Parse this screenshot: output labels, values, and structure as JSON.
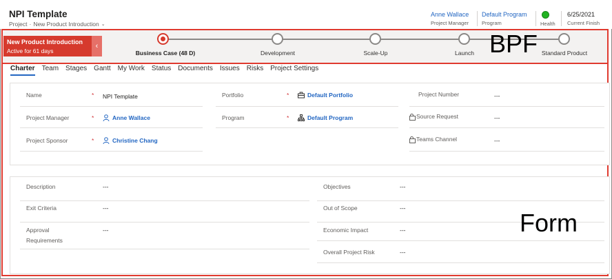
{
  "header": {
    "title": "NPI Template",
    "breadcrumb_entity": "Project",
    "breadcrumb_sep": "·",
    "breadcrumb_form": "New Product Introduction",
    "fields": [
      {
        "value": "Anne Wallace",
        "label": "Project Manager"
      },
      {
        "value": "Default Program",
        "label": "Program"
      },
      {
        "value": "",
        "label": "Health"
      },
      {
        "value": "6/25/2021",
        "label": "Current Finish"
      }
    ],
    "health_color": "#21b321"
  },
  "bpf": {
    "process_name": "New Product Introduction",
    "active_duration": "Active for 61 days",
    "stages": [
      {
        "label": "Business Case  (48 D)",
        "active": true
      },
      {
        "label": "Development",
        "active": false
      },
      {
        "label": "Scale-Up",
        "active": false
      },
      {
        "label": "Launch",
        "active": false
      },
      {
        "label": "Standard Product",
        "active": false
      }
    ],
    "annotation": "BPF",
    "active_color": "#d63a2d"
  },
  "form": {
    "annotation": "Form",
    "tabs": [
      "Charter",
      "Team",
      "Stages",
      "Gantt",
      "My Work",
      "Status",
      "Documents",
      "Issues",
      "Risks",
      "Project Settings"
    ],
    "active_tab": "Charter",
    "general": {
      "col1": [
        {
          "label": "Name",
          "required": "*",
          "value": "NPI Template"
        },
        {
          "label": "Project Manager",
          "required": "*",
          "value": "Anne Wallace"
        },
        {
          "label": "Project Sponsor",
          "required": "*",
          "value": "Christine Chang"
        }
      ],
      "col2": [
        {
          "label": "Portfolio",
          "required": "*",
          "value": "Default Portfolio"
        },
        {
          "label": "Program",
          "required": "*",
          "value": "Default Program"
        }
      ],
      "col3": [
        {
          "label": "Project Number",
          "value": "---"
        },
        {
          "label": "Source Request",
          "value": "---"
        },
        {
          "label": "Teams Channel",
          "value": "---"
        }
      ]
    },
    "details": {
      "left": [
        {
          "label": "Description",
          "value": "---"
        },
        {
          "label": "Exit Criteria",
          "value": "---"
        },
        {
          "label_line1": "Approval",
          "label_line2": "Requirements",
          "value": "---"
        }
      ],
      "right": [
        {
          "label": "Objectives",
          "value": "---"
        },
        {
          "label": "Out of Scope",
          "value": "---"
        },
        {
          "label": "Economic Impact",
          "value": "---"
        },
        {
          "label": "Overall Project Risk",
          "value": "---"
        }
      ]
    }
  },
  "colors": {
    "accent": "#2266c2",
    "bpf_border": "#e03a2f"
  }
}
